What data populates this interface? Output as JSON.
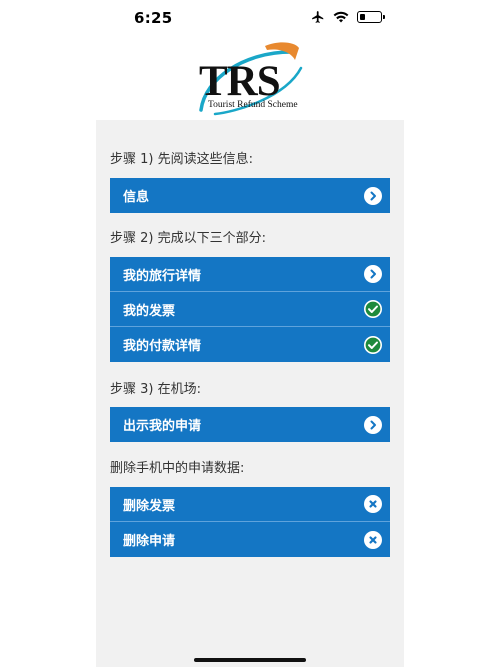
{
  "status_bar": {
    "time": "6:25"
  },
  "logo": {
    "letters": "TRS",
    "subtitle": "Tourist Refund Scheme",
    "accent_color": "#1aa7c8",
    "swoosh_color": "#e8892f"
  },
  "steps": {
    "step1": {
      "label": "步骤 1) 先阅读这些信息:",
      "items": [
        {
          "label": "信息",
          "icon": "chevron-right-icon"
        }
      ]
    },
    "step2": {
      "label": "步骤 2) 完成以下三个部分:",
      "items": [
        {
          "label": "我的旅行详情",
          "icon": "chevron-right-icon"
        },
        {
          "label": "我的发票",
          "icon": "check-circle-icon"
        },
        {
          "label": "我的付款详情",
          "icon": "check-circle-icon"
        }
      ]
    },
    "step3": {
      "label": "步骤 3) 在机场:",
      "items": [
        {
          "label": "出示我的申请",
          "icon": "chevron-right-icon"
        }
      ]
    },
    "delete": {
      "label": "删除手机中的申请数据:",
      "items": [
        {
          "label": "删除发票",
          "icon": "close-icon"
        },
        {
          "label": "删除申请",
          "icon": "close-icon"
        }
      ]
    }
  },
  "colors": {
    "button_blue": "#1476c4",
    "check_green": "#1e8a3c",
    "panel_bg": "#f1f1f1"
  }
}
